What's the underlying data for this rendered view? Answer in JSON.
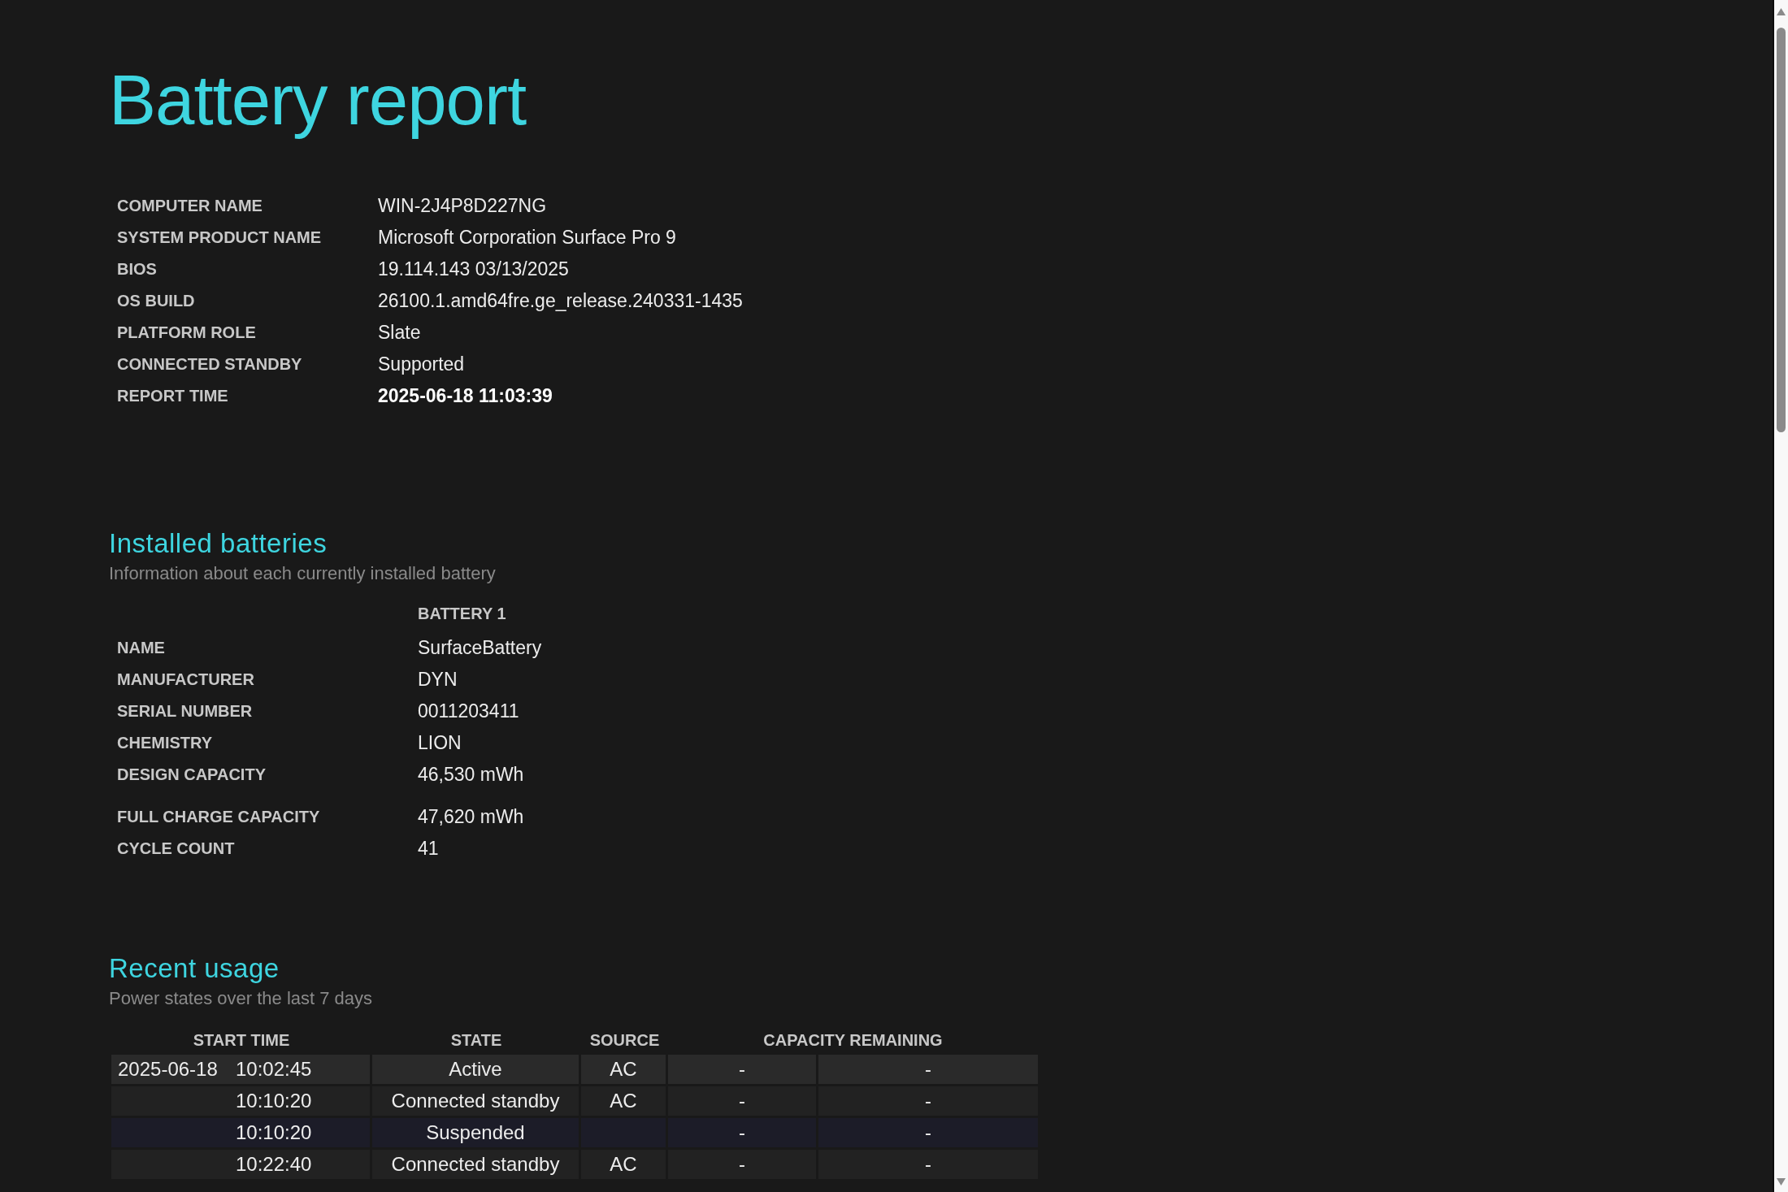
{
  "title": "Battery report",
  "system_info": [
    {
      "label": "COMPUTER NAME",
      "value": "WIN-2J4P8D227NG",
      "emphasis": false
    },
    {
      "label": "SYSTEM PRODUCT NAME",
      "value": "Microsoft Corporation Surface Pro 9",
      "emphasis": false
    },
    {
      "label": "BIOS",
      "value": "19.114.143 03/13/2025",
      "emphasis": false
    },
    {
      "label": "OS BUILD",
      "value": "26100.1.amd64fre.ge_release.240331-1435",
      "emphasis": false
    },
    {
      "label": "PLATFORM ROLE",
      "value": "Slate",
      "emphasis": false
    },
    {
      "label": "CONNECTED STANDBY",
      "value": "Supported",
      "emphasis": false
    },
    {
      "label": "REPORT TIME",
      "value": "2025-06-18  11:03:39",
      "emphasis": true
    }
  ],
  "installed_batteries": {
    "heading": "Installed batteries",
    "subtitle": "Information about each currently installed battery",
    "column": "BATTERY 1",
    "row_groups": [
      [
        {
          "label": "NAME",
          "value": "SurfaceBattery"
        },
        {
          "label": "MANUFACTURER",
          "value": "DYN"
        },
        {
          "label": "SERIAL NUMBER",
          "value": "0011203411"
        },
        {
          "label": "CHEMISTRY",
          "value": "LION"
        },
        {
          "label": "DESIGN CAPACITY",
          "value": "46,530 mWh"
        }
      ],
      [
        {
          "label": "FULL CHARGE CAPACITY",
          "value": "47,620 mWh"
        },
        {
          "label": "CYCLE COUNT",
          "value": "41"
        }
      ]
    ]
  },
  "recent_usage": {
    "heading": "Recent usage",
    "subtitle": "Power states over the last 7 days",
    "columns": [
      "START TIME",
      "STATE",
      "SOURCE",
      "CAPACITY REMAINING"
    ],
    "rows": [
      {
        "kind": "active",
        "date": "2025-06-18",
        "time": "10:02:45",
        "state": "Active",
        "source": "AC",
        "capacity_1": "-",
        "capacity_2": "-"
      },
      {
        "kind": "standby",
        "time": "10:10:20",
        "state": "Connected standby",
        "source": "AC",
        "capacity_1": "-",
        "capacity_2": "-"
      },
      {
        "kind": "suspended",
        "time": "10:10:20",
        "state": "Suspended",
        "capacity_1": "-",
        "capacity_2": "-"
      },
      {
        "kind": "standby",
        "time": "10:22:40",
        "state": "Connected standby",
        "source": "AC",
        "capacity_1": "-",
        "capacity_2": "-"
      }
    ]
  }
}
